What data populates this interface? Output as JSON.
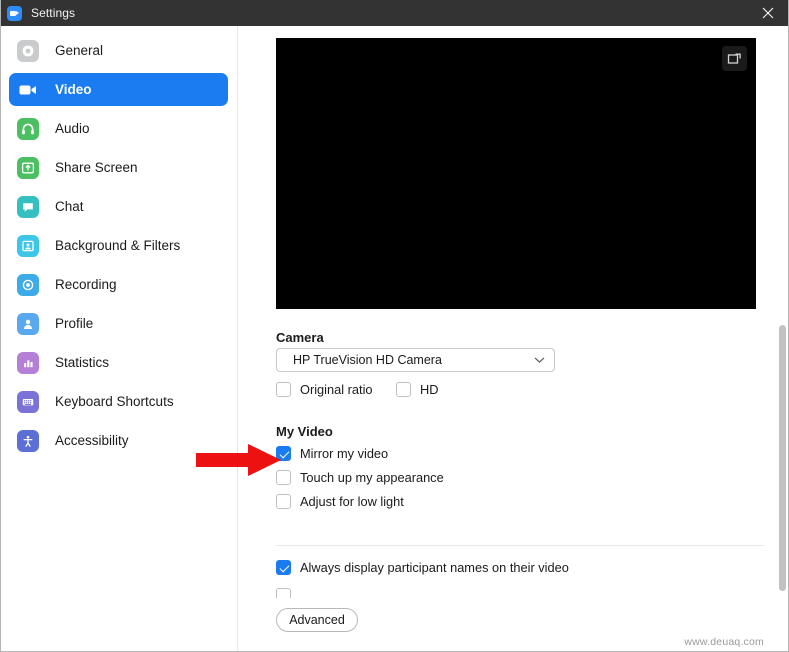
{
  "window": {
    "title": "Settings",
    "app_icon": "zoom-video-icon",
    "close_label": "✕",
    "accent_color": "#1a7cf0",
    "titlebar_color": "#333333"
  },
  "sidebar": {
    "items": [
      {
        "label": "General",
        "icon": "gear-icon",
        "icon_color": "#c9cbcd",
        "active": false
      },
      {
        "label": "Video",
        "icon": "video-camera-icon",
        "icon_color": "#1a7cf0",
        "active": true
      },
      {
        "label": "Audio",
        "icon": "headphones-icon",
        "icon_color": "#4cbf63",
        "active": false
      },
      {
        "label": "Share Screen",
        "icon": "share-screen-icon",
        "icon_color": "#4cbf63",
        "active": false
      },
      {
        "label": "Chat",
        "icon": "chat-bubble-icon",
        "icon_color": "#35bfc0",
        "active": false
      },
      {
        "label": "Background & Filters",
        "icon": "background-filters-icon",
        "icon_color": "#3dc6e8",
        "active": false
      },
      {
        "label": "Recording",
        "icon": "record-circle-icon",
        "icon_color": "#3dabe8",
        "active": false
      },
      {
        "label": "Profile",
        "icon": "person-icon",
        "icon_color": "#5aa9f0",
        "active": false
      },
      {
        "label": "Statistics",
        "icon": "bar-chart-icon",
        "icon_color": "#b57fd6",
        "active": false
      },
      {
        "label": "Keyboard Shortcuts",
        "icon": "keyboard-icon",
        "icon_color": "#7a72d6",
        "active": false
      },
      {
        "label": "Accessibility",
        "icon": "accessibility-icon",
        "icon_color": "#5b6fd6",
        "active": false
      }
    ]
  },
  "main": {
    "preview": {
      "popout_icon": "pop-out-video-icon",
      "state": "black-no-video"
    },
    "camera": {
      "section_label": "Camera",
      "selected": "HP TrueVision HD Camera",
      "options": [
        "HP TrueVision HD Camera"
      ],
      "checkboxes": [
        {
          "label": "Original ratio",
          "checked": false
        },
        {
          "label": "HD",
          "checked": false
        }
      ]
    },
    "my_video": {
      "section_label": "My Video",
      "checkboxes": [
        {
          "label": "Mirror my video",
          "checked": true
        },
        {
          "label": "Touch up my appearance",
          "checked": false
        },
        {
          "label": "Adjust for low light",
          "checked": false
        }
      ]
    },
    "meetings": {
      "checkboxes": [
        {
          "label": "Always display participant names on their video",
          "checked": true
        }
      ]
    },
    "advanced_button": "Advanced"
  },
  "annotation": {
    "arrow_color": "#ee1111",
    "points_at": "Mirror my video checkbox"
  },
  "watermark": "www.deuaq.com"
}
